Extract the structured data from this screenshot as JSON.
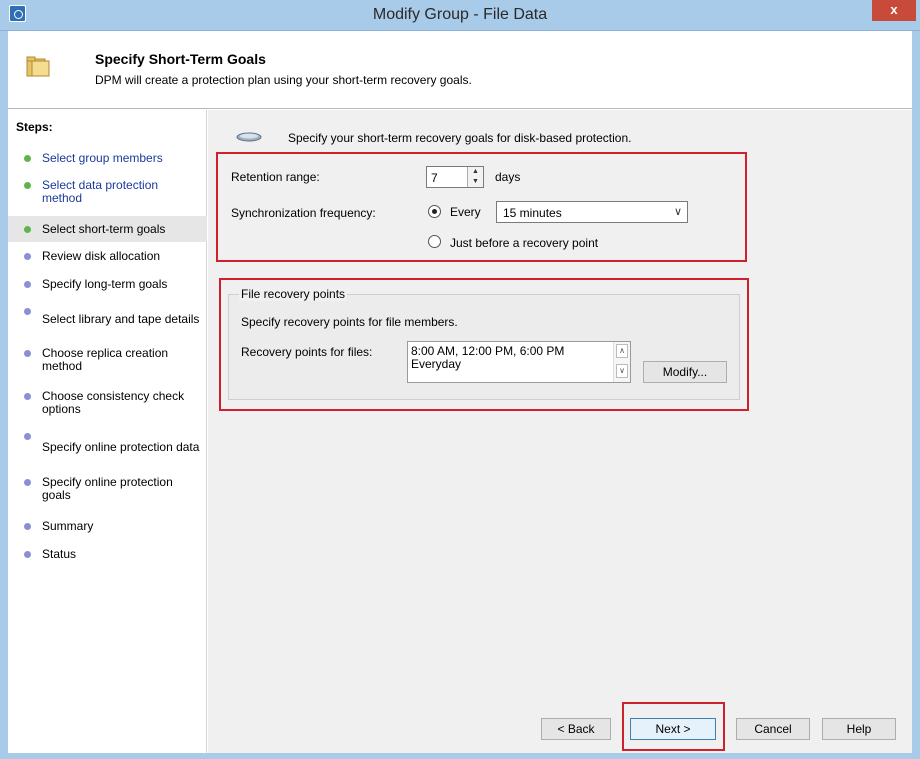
{
  "window": {
    "title": "Modify Group - File Data",
    "close_label": "x"
  },
  "header": {
    "title": "Specify Short-Term Goals",
    "subtitle": "DPM will create a protection plan using your short-term recovery goals."
  },
  "steps": {
    "title": "Steps:",
    "items": [
      {
        "label": "Select group members"
      },
      {
        "label": "Select data protection method"
      },
      {
        "label": "Select short-term goals"
      },
      {
        "label": "Review disk allocation"
      },
      {
        "label": "Specify long-term goals"
      },
      {
        "label": "Select library and tape details"
      },
      {
        "label": "Choose replica creation method"
      },
      {
        "label": "Choose consistency check options"
      },
      {
        "label": "Specify online protection data"
      },
      {
        "label": "Specify online protection goals"
      },
      {
        "label": "Summary"
      },
      {
        "label": "Status"
      }
    ]
  },
  "main": {
    "intro": "Specify your short-term recovery goals for disk-based protection.",
    "retention_label": "Retention range:",
    "retention_value": "7",
    "retention_unit": "days",
    "sync_label": "Synchronization frequency:",
    "every_label": "Every",
    "every_selected": "15 minutes",
    "just_before_label": "Just before a recovery point",
    "file_recovery": {
      "title": "File recovery points",
      "description": "Specify recovery points for file members.",
      "points_label": "Recovery points for files:",
      "points_line1": "8:00 AM, 12:00 PM, 6:00 PM",
      "points_line2": "Everyday",
      "modify_label": "Modify..."
    }
  },
  "footer": {
    "back_label": "< Back",
    "next_label": "Next >",
    "cancel_label": "Cancel",
    "help_label": "Help"
  },
  "colors": {
    "highlight_red": "#d0202e",
    "titlebar": "#a9cbea",
    "close_red": "#c74a3b",
    "link_blue": "#1b3a9c"
  }
}
